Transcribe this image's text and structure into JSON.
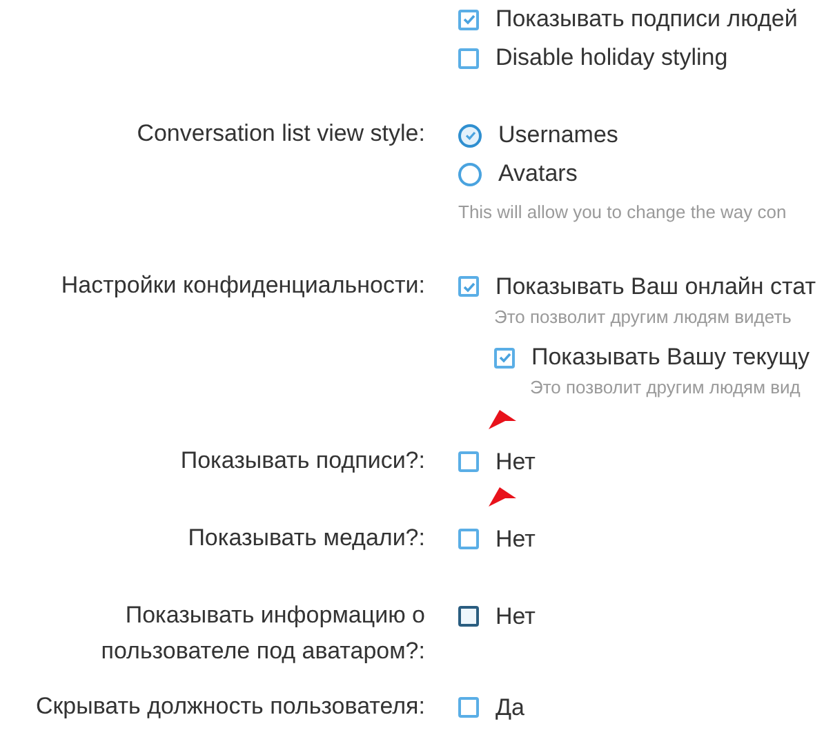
{
  "sections": [
    {
      "options": [
        {
          "kind": "checkbox",
          "text": "Показывать подписи людей",
          "checked": true
        },
        {
          "kind": "checkbox",
          "text": "Disable holiday styling",
          "checked": false
        }
      ]
    },
    {
      "label": "Conversation list view style:",
      "options": [
        {
          "kind": "radio",
          "text": "Usernames",
          "selected": true
        },
        {
          "kind": "radio",
          "text": "Avatars",
          "selected": false
        }
      ],
      "hint": "This will allow you to change the way con"
    },
    {
      "label": "Настройки конфиденциальности:",
      "options": [
        {
          "kind": "checkbox",
          "text": "Показывать Ваш онлайн стат",
          "checked": true,
          "hint": "Это позволит другим людям видеть",
          "children": [
            {
              "kind": "checkbox",
              "text": "Показывать Вашу текущу",
              "checked": true,
              "hint": "Это позволит другим людям вид"
            }
          ]
        }
      ]
    },
    {
      "label": "Показывать подписи?:",
      "options": [
        {
          "kind": "checkbox",
          "text": "Нет",
          "checked": false,
          "highlighted": false,
          "annotated": true
        }
      ]
    },
    {
      "label": "Показывать медали?:",
      "options": [
        {
          "kind": "checkbox",
          "text": "Нет",
          "checked": false,
          "highlighted": false,
          "annotated": true
        }
      ]
    },
    {
      "label": "Показывать информацию о пользователе под аватаром?:",
      "options": [
        {
          "kind": "checkbox",
          "text": "Нет",
          "checked": false,
          "highlighted": true,
          "annotated": false
        }
      ]
    },
    {
      "label": "Скрывать должность пользователя:",
      "options": [
        {
          "kind": "checkbox",
          "text": "Да",
          "checked": false,
          "highlighted": false,
          "annotated": false
        }
      ]
    }
  ]
}
